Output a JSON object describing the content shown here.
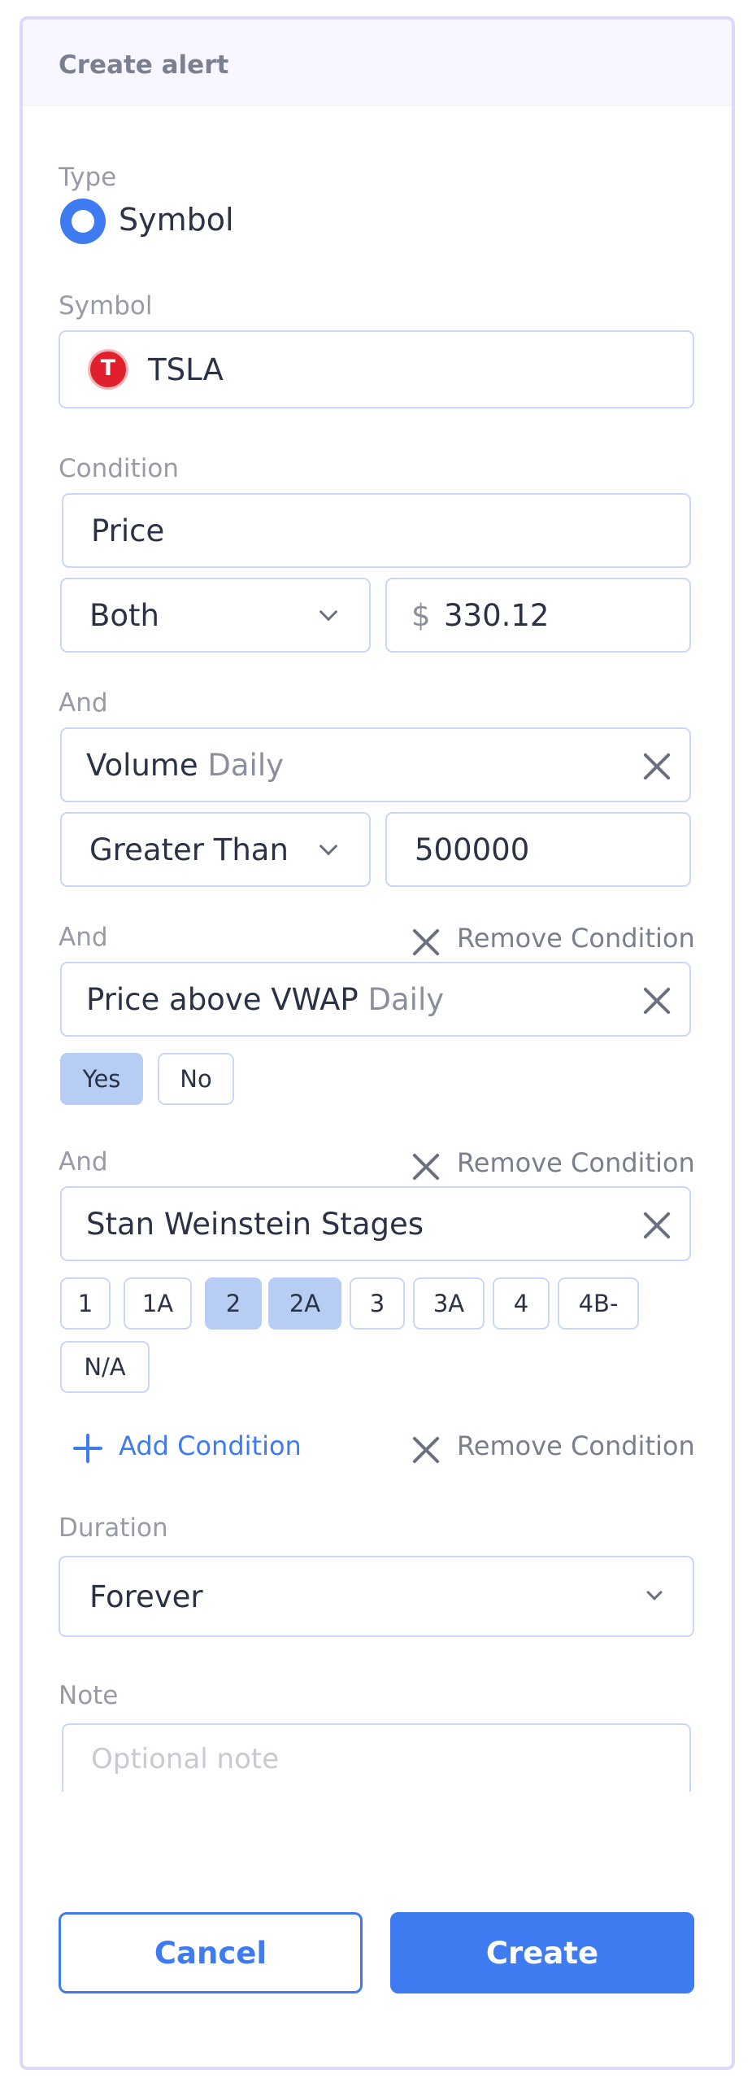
{
  "header": {
    "title": "Create alert"
  },
  "type": {
    "label": "Type",
    "option": "Symbol"
  },
  "symbol": {
    "label": "Symbol",
    "value": "TSLA",
    "logo_glyph": "T",
    "logo_icon": "tesla-logo-icon"
  },
  "condition_label": "Condition",
  "price_condition": {
    "field": "Price",
    "operator": "Both",
    "currency": "$",
    "value": "330.12"
  },
  "conditions": [
    {
      "join": "And",
      "field": "Volume",
      "timeframe": "Daily",
      "operator": "Greater Than",
      "value": "500000"
    },
    {
      "join": "And",
      "remove_label": "Remove Condition",
      "field": "Price above VWAP",
      "timeframe": "Daily",
      "options": [
        {
          "label": "Yes",
          "selected": true
        },
        {
          "label": "No",
          "selected": false
        }
      ]
    },
    {
      "join": "And",
      "remove_label": "Remove Condition",
      "field": "Stan Weinstein Stages",
      "options": [
        {
          "label": "1",
          "selected": false
        },
        {
          "label": "1A",
          "selected": false
        },
        {
          "label": "2",
          "selected": true
        },
        {
          "label": "2A",
          "selected": true
        },
        {
          "label": "3",
          "selected": false
        },
        {
          "label": "3A",
          "selected": false
        },
        {
          "label": "4",
          "selected": false
        },
        {
          "label": "4B-",
          "selected": false
        },
        {
          "label": "N/A",
          "selected": false
        }
      ]
    }
  ],
  "actions": {
    "add_label": "Add Condition",
    "remove_label": "Remove Condition"
  },
  "duration": {
    "label": "Duration",
    "value": "Forever"
  },
  "note": {
    "label": "Note",
    "placeholder": "Optional note"
  },
  "footer": {
    "cancel": "Cancel",
    "create": "Create"
  },
  "colors": {
    "accent": "#3f7bf0",
    "selected_pill": "#b7cdf4",
    "border": "#c9d7f5",
    "header_bg": "#f8f6fe"
  }
}
